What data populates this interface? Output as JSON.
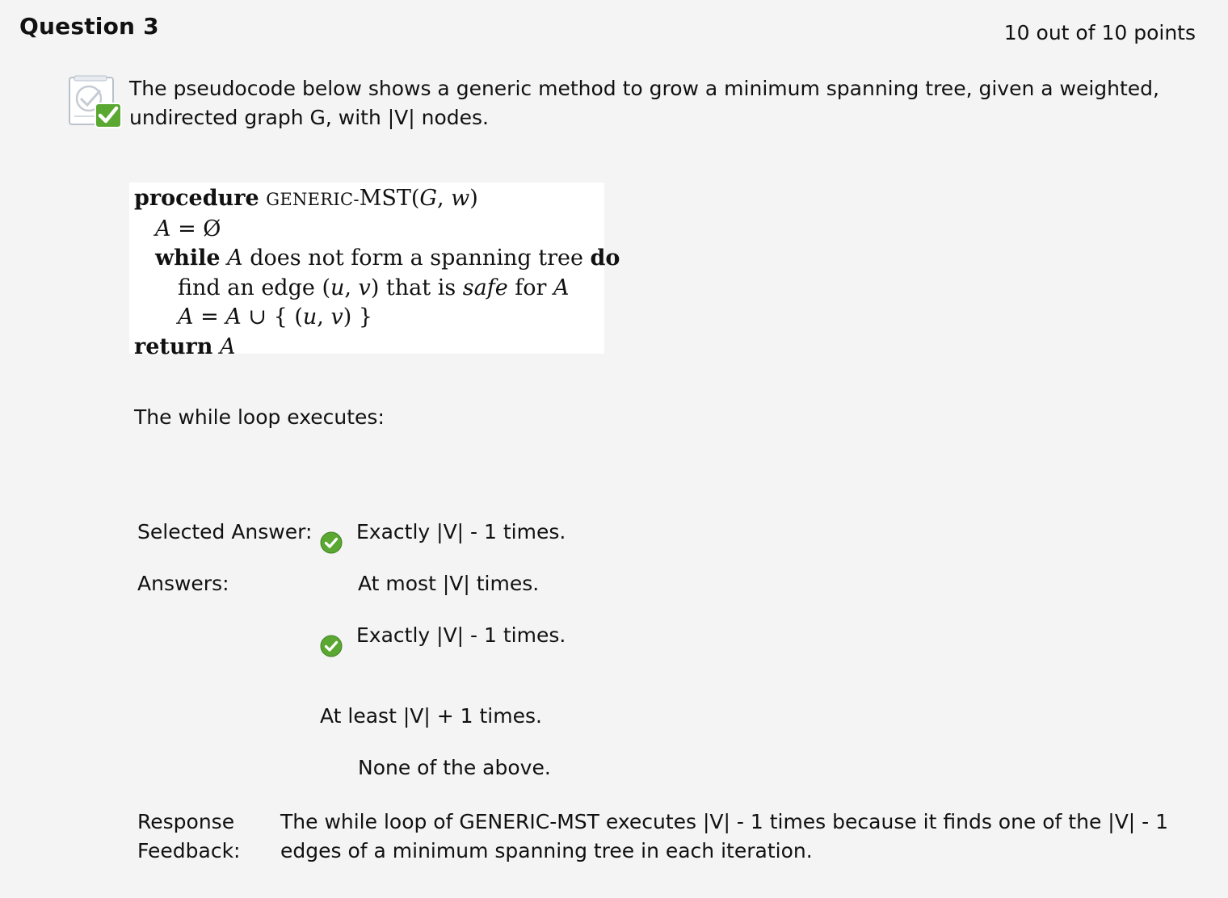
{
  "question": {
    "title": "Question 3",
    "points": "10 out of 10 points",
    "prompt": "The pseudocode below shows a generic method to grow a minimum spanning tree, given a weighted, undirected graph G, with |V| nodes.",
    "status_icon": "correct-check-icon"
  },
  "pseudocode": {
    "line1": {
      "kw": "procedure",
      "name_sc": "GENERIC-",
      "name": "MST(",
      "g": "G",
      "comma": ", ",
      "w": "w",
      "close": ")"
    },
    "line2": {
      "a": "A",
      "rest": " = Ø"
    },
    "line3": {
      "kw": "while",
      "a": "A",
      "rest": " does not form a spanning tree ",
      "do": "do"
    },
    "line4": {
      "pre": "find an edge (",
      "u": "u",
      "comma": ", ",
      "v": "v",
      "mid": ") that is ",
      "safe": "safe",
      "for": " for ",
      "a": "A"
    },
    "line5": {
      "a1": "A",
      "eq": " = ",
      "a2": "A",
      "union": " ∪ { (",
      "u": "u",
      "comma": ", ",
      "v": "v",
      "close": ") }"
    },
    "line6": {
      "kw": "return",
      "a": "A"
    }
  },
  "stem": "The while loop executes:",
  "answers": {
    "selected_label": "Selected Answer:",
    "selected_value": "Exactly |V| - 1 times.",
    "answers_label": "Answers:",
    "options": [
      "At most |V| times.",
      "Exactly |V| - 1 times.",
      "At least |V| + 1 times.",
      "None of the above."
    ],
    "correct_index": 1
  },
  "feedback": {
    "label_line1": "Response",
    "label_line2": "Feedback:",
    "line1": "The while loop of GENERIC-MST executes |V| - 1 times because it finds one of the |V| - 1",
    "line2": "edges of a minimum spanning tree in each iteration."
  },
  "colors": {
    "background": "#f4f4f4",
    "check_green": "#5aa832"
  }
}
